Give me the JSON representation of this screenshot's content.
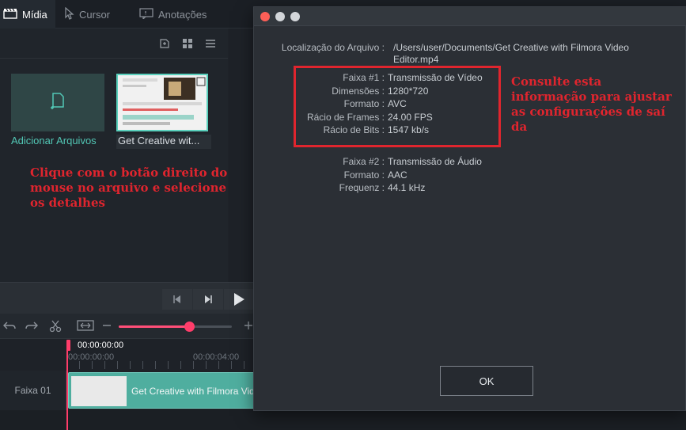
{
  "tabs": [
    {
      "label": "Mídia",
      "icon": "clapperboard-icon",
      "active": true
    },
    {
      "label": "Cursor",
      "icon": "cursor-icon",
      "active": false
    },
    {
      "label": "Anotações",
      "icon": "annotation-icon",
      "active": false
    }
  ],
  "media": {
    "add_label": "Adicionar Arquivos",
    "clip_label": "Get Creative wit...",
    "hint": "Clique com o botão direito do mouse no arquivo e selecione os detalhes"
  },
  "timeline": {
    "current_time": "00:00:00:00",
    "ruler_start": "00:00:00:00",
    "ruler_mark": "00:00:04:00",
    "track_name": "Faixa 01",
    "clip_title": "Get Creative with Filmora Video",
    "zoom_level": 0.62
  },
  "dialog": {
    "file_location_label": "Localização do Arquivo :",
    "file_location_value": "/Users/user/Documents/Get Creative with Filmora Video Editor.mp4",
    "track1": [
      {
        "label": "Faixa #1 :",
        "value": "Transmissão de Vídeo"
      },
      {
        "label": "Dimensões :",
        "value": "1280*720"
      },
      {
        "label": "Formato :",
        "value": "AVC"
      },
      {
        "label": "Rácio de Frames :",
        "value": "24.00 FPS"
      },
      {
        "label": "Rácio de Bits :",
        "value": "1547 kb/s"
      }
    ],
    "track2": [
      {
        "label": "Faixa #2 :",
        "value": "Transmissão de Áudio"
      },
      {
        "label": "Formato :",
        "value": "AAC"
      },
      {
        "label": "Frequenz :",
        "value": "44.1 kHz"
      }
    ],
    "hint": "Consulte esta informação para ajustar as configurações de saí da",
    "ok_label": "OK"
  },
  "colors": {
    "accent": "#52c7b5",
    "annotation_red": "#e0252e",
    "playhead": "#ff3d6a"
  }
}
